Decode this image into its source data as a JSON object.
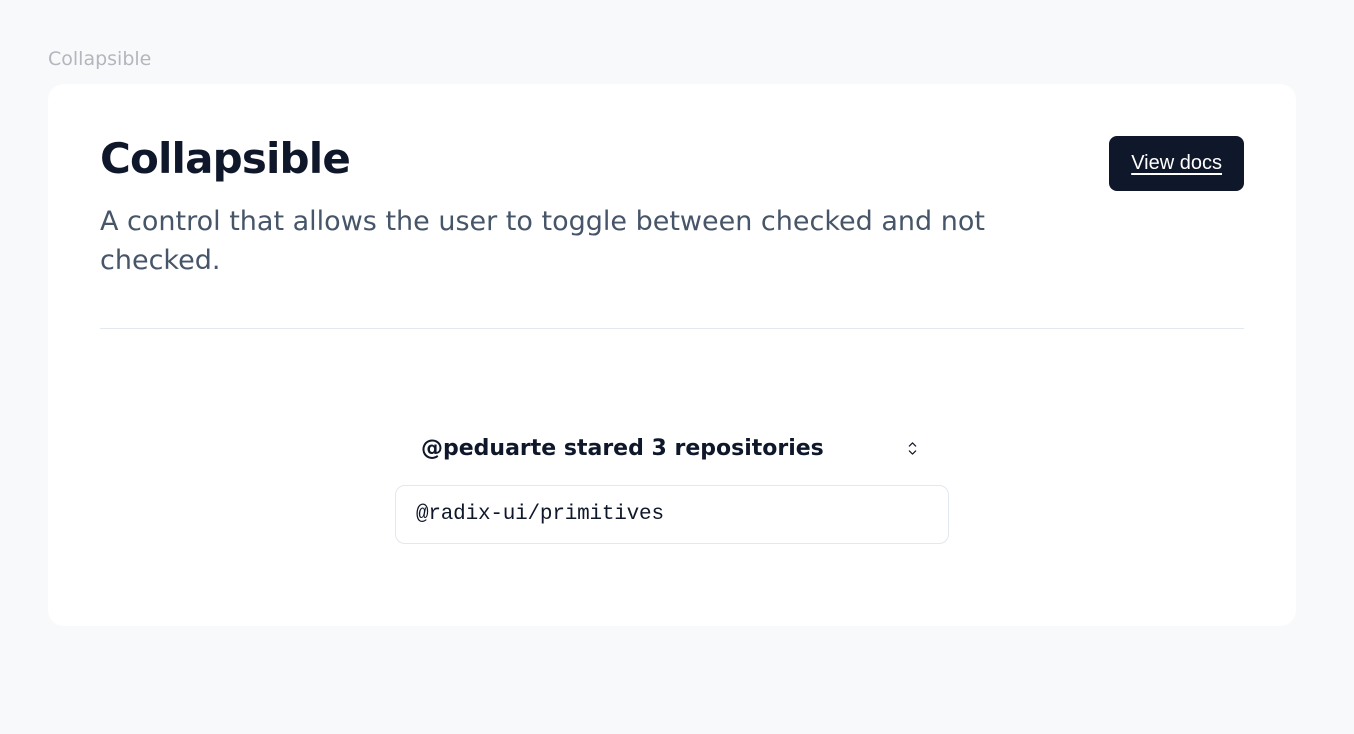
{
  "section": {
    "label": "Collapsible"
  },
  "header": {
    "title": "Collapsible",
    "description": "A control that allows the user to toggle between checked and not checked.",
    "docs_button": "View docs"
  },
  "collapsible": {
    "label": "@peduarte stared 3 repositories",
    "items": [
      "@radix-ui/primitives"
    ]
  }
}
